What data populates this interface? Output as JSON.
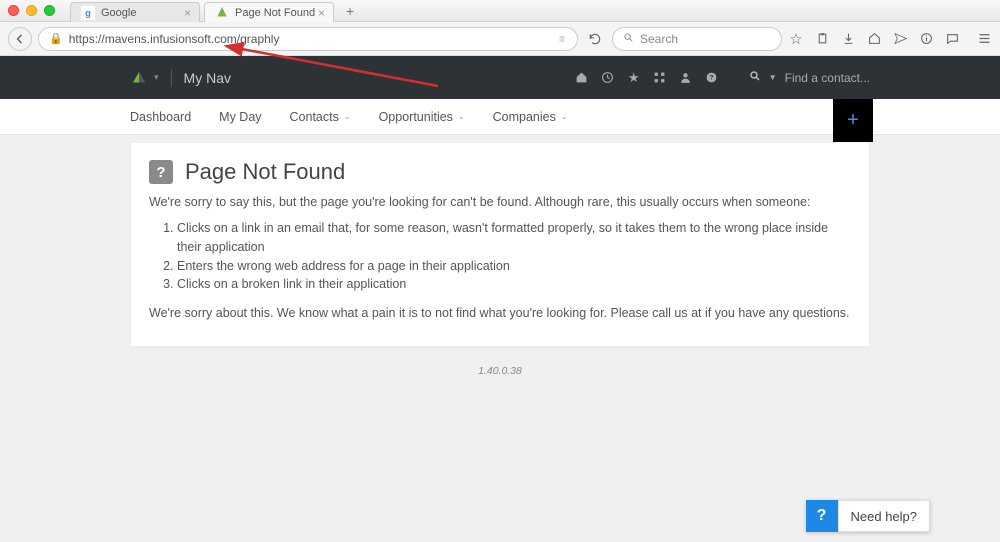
{
  "browser": {
    "tabs": [
      {
        "title": "Google",
        "favicon": "g"
      },
      {
        "title": "Page Not Found",
        "favicon": "is"
      }
    ],
    "url": "https://mavens.infusionsoft.com/graphly",
    "search_placeholder": "Search"
  },
  "header": {
    "nav_label": "My Nav",
    "find_placeholder": "Find a contact..."
  },
  "subnav": {
    "items": [
      {
        "label": "Dashboard",
        "has_caret": false
      },
      {
        "label": "My Day",
        "has_caret": false
      },
      {
        "label": "Contacts",
        "has_caret": true
      },
      {
        "label": "Opportunities",
        "has_caret": true
      },
      {
        "label": "Companies",
        "has_caret": true
      }
    ]
  },
  "page": {
    "title": "Page Not Found",
    "intro": "We're sorry to say this, but the page you're looking for can't be found. Although rare, this usually occurs when someone:",
    "reasons": [
      "Clicks on a link in an email that, for some reason, wasn't formatted properly, so it takes them to the wrong place inside their application",
      "Enters the wrong web address for a page in their application",
      "Clicks on a broken link in their application"
    ],
    "apology": "We're sorry about this. We know what a pain it is to not find what you're looking for. Please call us at if you have any questions.",
    "version": "1.40.0.38"
  },
  "help": {
    "label": "Need help?"
  }
}
